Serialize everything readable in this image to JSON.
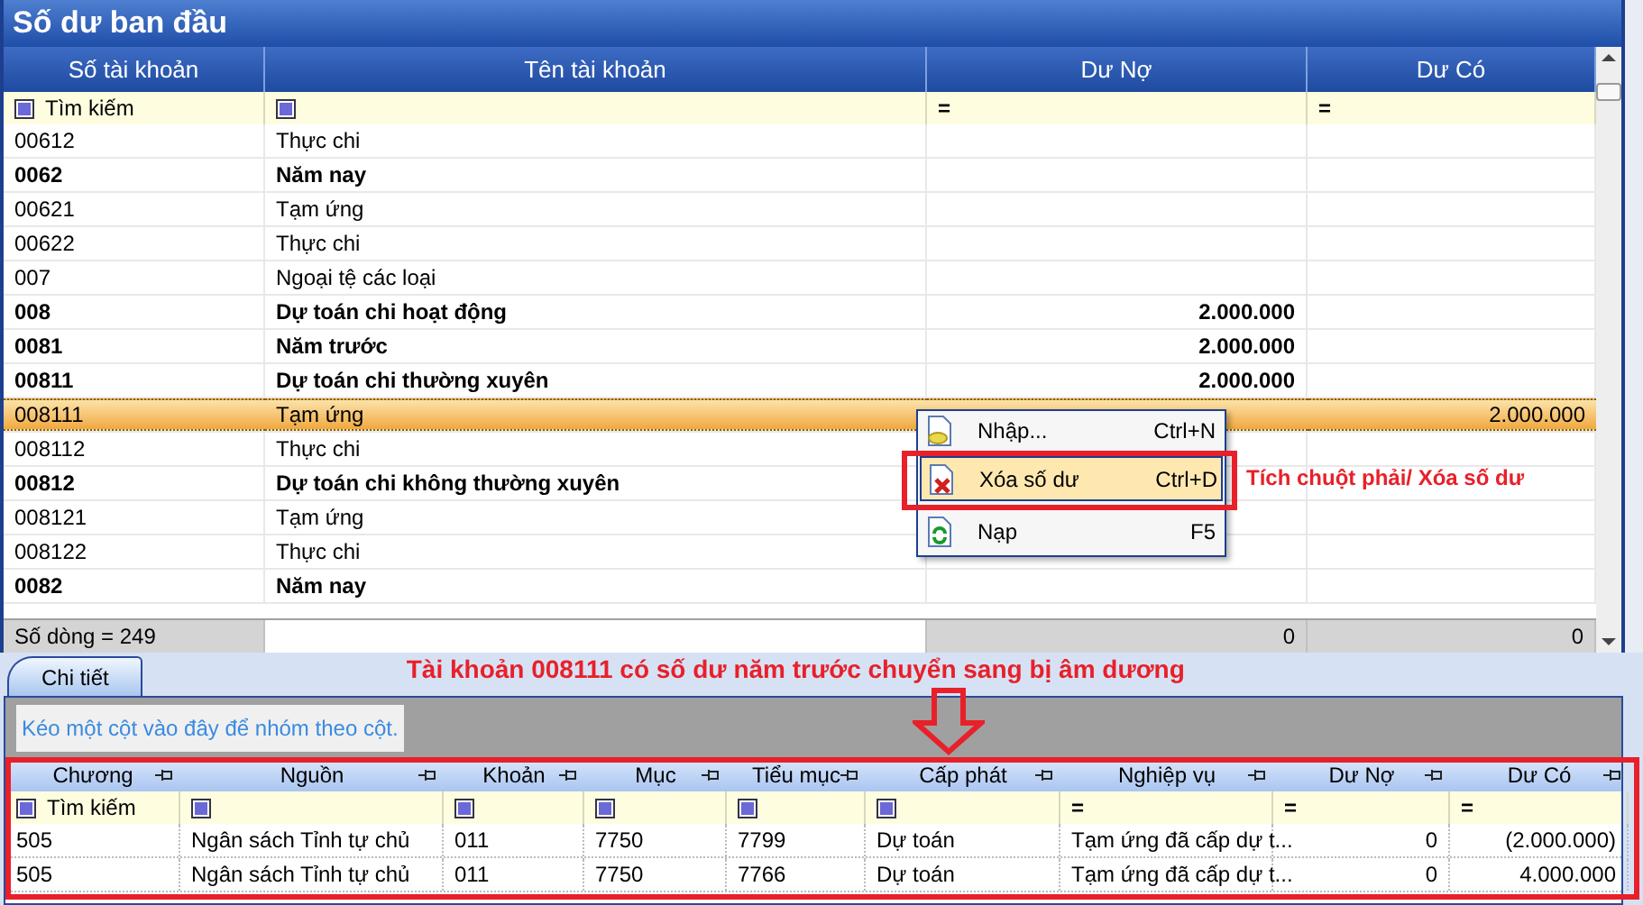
{
  "window": {
    "title": "Số dư ban đầu"
  },
  "table": {
    "columns": [
      "Số tài khoản",
      "Tên tài khoản",
      "Dư Nợ",
      "Dư Có"
    ],
    "filters": [
      {
        "kind": "checkbox",
        "text": "Tìm kiếm"
      },
      {
        "kind": "checkbox"
      },
      {
        "kind": "equals",
        "text": "="
      },
      {
        "kind": "equals",
        "text": "="
      }
    ],
    "rows": [
      {
        "cells": [
          "00612",
          "Thực chi",
          "",
          ""
        ],
        "bold": false,
        "selected": false
      },
      {
        "cells": [
          "0062",
          "Năm nay",
          "",
          ""
        ],
        "bold": true,
        "selected": false
      },
      {
        "cells": [
          "00621",
          "Tạm ứng",
          "",
          ""
        ],
        "bold": false,
        "selected": false
      },
      {
        "cells": [
          "00622",
          "Thực chi",
          "",
          ""
        ],
        "bold": false,
        "selected": false
      },
      {
        "cells": [
          "007",
          "Ngoại tệ các loại",
          "",
          ""
        ],
        "bold": false,
        "selected": false
      },
      {
        "cells": [
          "008",
          "Dự toán chi hoạt động",
          "2.000.000",
          ""
        ],
        "bold": true,
        "selected": false
      },
      {
        "cells": [
          "0081",
          "Năm trước",
          "2.000.000",
          ""
        ],
        "bold": true,
        "selected": false
      },
      {
        "cells": [
          "00811",
          "Dự toán chi thường xuyên",
          "2.000.000",
          ""
        ],
        "bold": true,
        "selected": false
      },
      {
        "cells": [
          "008111",
          "Tạm ứng",
          "",
          "2.000.000"
        ],
        "bold": false,
        "selected": true
      },
      {
        "cells": [
          "008112",
          "Thực chi",
          "",
          ""
        ],
        "bold": false,
        "selected": false
      },
      {
        "cells": [
          "00812",
          "Dự toán chi không thường xuyên",
          "",
          ""
        ],
        "bold": true,
        "selected": false
      },
      {
        "cells": [
          "008121",
          "Tạm ứng",
          "",
          ""
        ],
        "bold": false,
        "selected": false
      },
      {
        "cells": [
          "008122",
          "Thực chi",
          "",
          ""
        ],
        "bold": false,
        "selected": false
      },
      {
        "cells": [
          "0082",
          "Năm nay",
          "",
          ""
        ],
        "bold": true,
        "selected": false
      }
    ],
    "footer": {
      "label": "Số dòng = 249",
      "totals": [
        "0",
        "0"
      ]
    }
  },
  "context_menu": {
    "items": [
      {
        "label": "Nhập...",
        "shortcut": "Ctrl+N",
        "kind": "import",
        "selected": false
      },
      {
        "label": "Xóa số dư",
        "shortcut": "Ctrl+D",
        "kind": "delete",
        "selected": true
      },
      {
        "label": "Nạp",
        "shortcut": "F5",
        "kind": "reload",
        "selected": false
      }
    ]
  },
  "annotations": {
    "menu_note": "Tích chuột phải/ Xóa số dư",
    "detail_note": "Tài khoản 008111 có số dư năm trước chuyển sang bị âm dương"
  },
  "tabs": [
    {
      "label": "Chi tiết",
      "selected": true
    }
  ],
  "detail": {
    "group_hint": "Kéo một cột vào đây để nhóm theo cột.",
    "columns": [
      "Chương",
      "Nguồn",
      "Khoản",
      "Mục",
      "Tiểu mục",
      "Cấp phát",
      "Nghiệp vụ",
      "Dư Nợ",
      "Dư Có"
    ],
    "filters": [
      {
        "kind": "checkbox",
        "text": "Tìm kiếm"
      },
      {
        "kind": "checkbox"
      },
      {
        "kind": "checkbox"
      },
      {
        "kind": "checkbox"
      },
      {
        "kind": "checkbox"
      },
      {
        "kind": "checkbox"
      },
      {
        "kind": "equals",
        "text": "="
      },
      {
        "kind": "equals",
        "text": "="
      },
      {
        "kind": "equals",
        "text": "="
      }
    ],
    "rows": [
      [
        "505",
        "Ngân sách Tỉnh tự chủ",
        "011",
        "7750",
        "7799",
        "Dự toán",
        "Tạm ứng đã cấp dự t...",
        "0",
        "(2.000.000)"
      ],
      [
        "505",
        "Ngân sách Tỉnh tự chủ",
        "011",
        "7750",
        "7766",
        "Dự toán",
        "Tạm ứng đã cấp dự t...",
        "0",
        "4.000.000"
      ]
    ]
  }
}
